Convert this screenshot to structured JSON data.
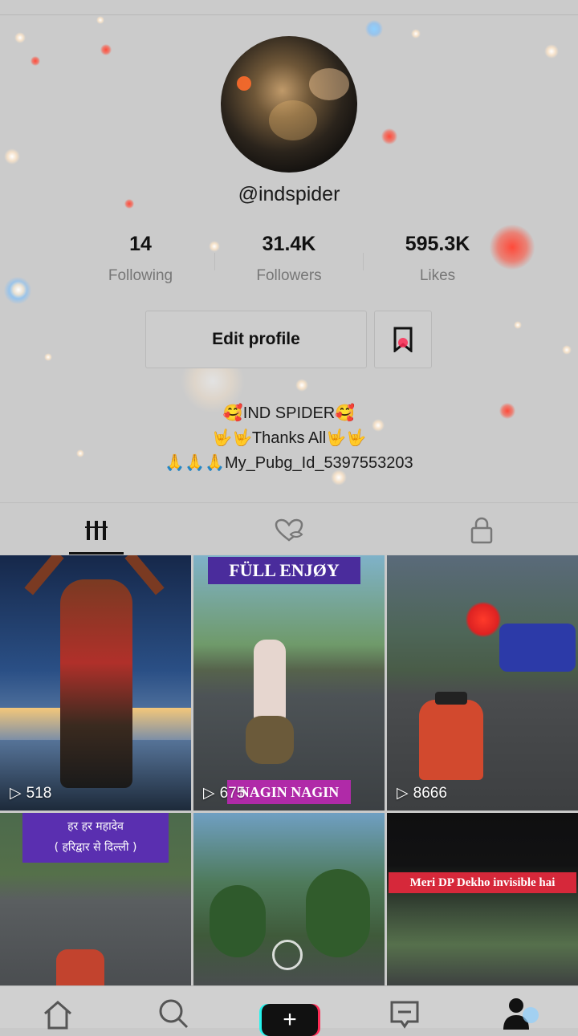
{
  "profile": {
    "username": "@indspider",
    "stats": [
      {
        "value": "14",
        "label": "Following"
      },
      {
        "value": "31.4K",
        "label": "Followers"
      },
      {
        "value": "595.3K",
        "label": "Likes"
      }
    ],
    "edit_profile_label": "Edit profile",
    "bio": [
      "🥰IND SPIDER🥰",
      "🤟🤟Thanks All🤟🤟",
      "🙏🙏🙏My_Pubg_Id_5397553203"
    ]
  },
  "tabs": [
    {
      "name": "videos",
      "icon": "grid-bars-icon",
      "active": true
    },
    {
      "name": "liked",
      "icon": "heart-hidden-icon",
      "active": false
    },
    {
      "name": "private",
      "icon": "lock-icon",
      "active": false
    }
  ],
  "videos": [
    {
      "views": "518",
      "banner": ""
    },
    {
      "views": "675",
      "banner_top": "FÜLL ENJØY",
      "banner_bottom": "NAGIN NAGIN"
    },
    {
      "views": "8666",
      "banner": ""
    },
    {
      "views": "",
      "banner_lines": [
        "हर हर महादेव",
        "( हरिद्वार से दिल्ली )"
      ]
    },
    {
      "views": "",
      "banner": ""
    },
    {
      "views": "",
      "banner": "Meri DP Dekho invisible hai"
    }
  ],
  "bottom_nav": [
    {
      "name": "home",
      "icon": "home-icon"
    },
    {
      "name": "discover",
      "icon": "search-icon"
    },
    {
      "name": "create",
      "icon": "plus-icon"
    },
    {
      "name": "inbox",
      "icon": "inbox-icon"
    },
    {
      "name": "me",
      "icon": "profile-icon"
    }
  ],
  "colors": {
    "accent_cyan": "#25f4ee",
    "accent_red": "#fe2c55",
    "banner_purple": "#5a2fb0"
  }
}
